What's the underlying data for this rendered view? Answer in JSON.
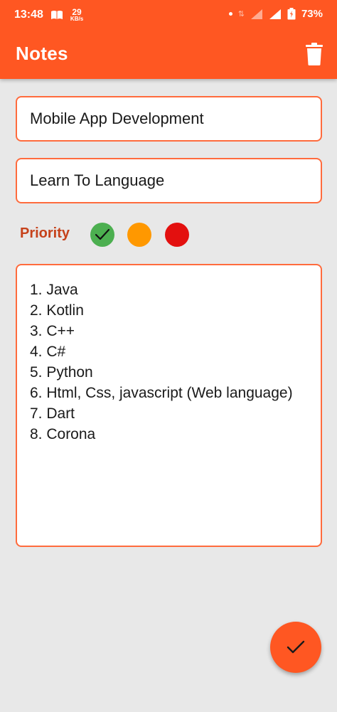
{
  "status_bar": {
    "time": "13:48",
    "speed_value": "29",
    "speed_unit": "KB/s",
    "battery_percent": "73%",
    "icons": [
      "book-icon",
      "data-arrows-icon",
      "signal-icon",
      "battery-icon"
    ]
  },
  "app_bar": {
    "title": "Notes",
    "delete_icon": "trash-icon"
  },
  "form": {
    "title_value": "Mobile App Development",
    "subtitle_value": "Learn To Language",
    "priority_label": "Priority",
    "priority_options": [
      {
        "name": "green",
        "color": "#4caf50",
        "selected": true
      },
      {
        "name": "orange",
        "color": "#ff9800",
        "selected": false
      },
      {
        "name": "red",
        "color": "#e3100f",
        "selected": false
      }
    ],
    "notes_value": "1. Java\n2. Kotlin\n3. C++\n4. C#\n5. Python\n6. Html, Css, javascript (Web language)\n7. Dart\n8. Corona"
  },
  "fab": {
    "icon": "check-icon"
  },
  "colors": {
    "accent": "#ff5722",
    "background": "#e8e8e8",
    "priority_text": "#c6421b"
  }
}
